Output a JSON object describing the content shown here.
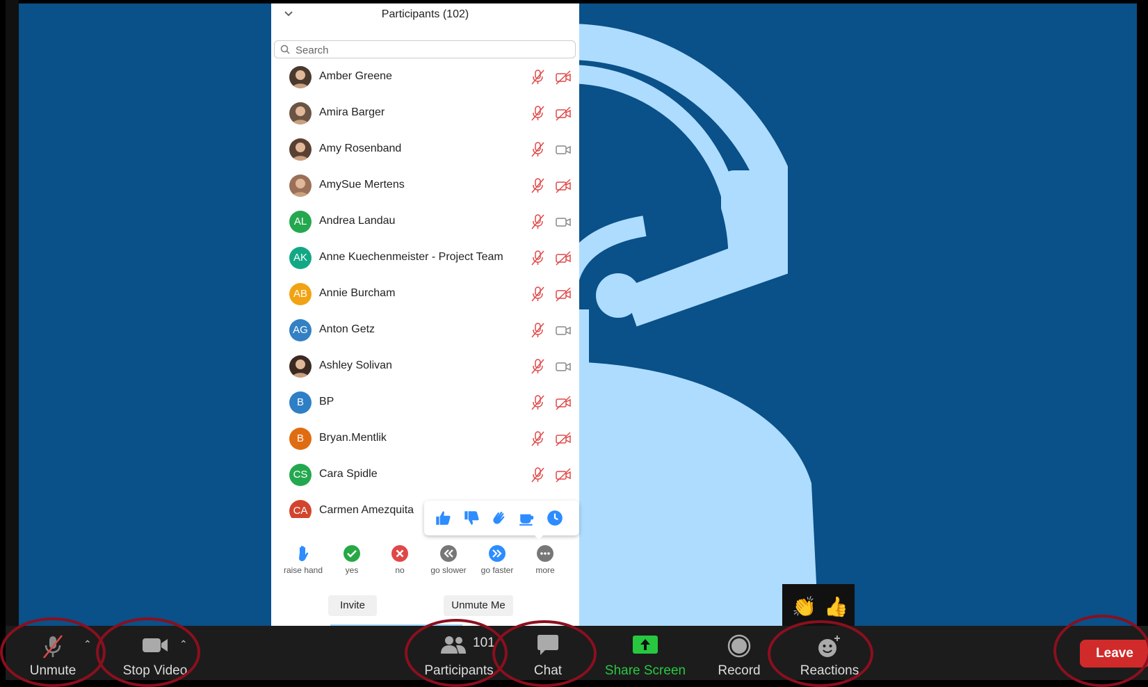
{
  "panel": {
    "title": "Participants (102)",
    "search_placeholder": "Search",
    "participants": [
      {
        "name": "Amber Greene",
        "initials": "",
        "avatar_color": "#4a3a2e",
        "mic": "muted",
        "video": "off"
      },
      {
        "name": "Amira Barger",
        "initials": "",
        "avatar_color": "#6b5443",
        "mic": "muted",
        "video": "off"
      },
      {
        "name": "Amy Rosenband",
        "initials": "",
        "avatar_color": "#5a4033",
        "mic": "muted",
        "video": "on"
      },
      {
        "name": "AmySue Mertens",
        "initials": "",
        "avatar_color": "#9a7058",
        "mic": "muted",
        "video": "off"
      },
      {
        "name": "Andrea Landau",
        "initials": "AL",
        "avatar_color": "#24a84f",
        "mic": "muted",
        "video": "on"
      },
      {
        "name": "Anne Kuechenmeister - Project Team",
        "initials": "AK",
        "avatar_color": "#12a886",
        "mic": "muted",
        "video": "off"
      },
      {
        "name": "Annie Burcham",
        "initials": "AB",
        "avatar_color": "#f2a313",
        "mic": "muted",
        "video": "off"
      },
      {
        "name": "Anton Getz",
        "initials": "AG",
        "avatar_color": "#3380c4",
        "mic": "muted",
        "video": "on"
      },
      {
        "name": "Ashley Solivan",
        "initials": "",
        "avatar_color": "#3b2a22",
        "mic": "muted",
        "video": "on"
      },
      {
        "name": "BP",
        "initials": "B",
        "avatar_color": "#2e7fc5",
        "mic": "muted",
        "video": "off"
      },
      {
        "name": "Bryan.Mentlik",
        "initials": "B",
        "avatar_color": "#e06c12",
        "mic": "muted",
        "video": "off"
      },
      {
        "name": "Cara Spidle",
        "initials": "CS",
        "avatar_color": "#24a84f",
        "mic": "muted",
        "video": "off"
      },
      {
        "name": "Carmen Amezquita",
        "initials": "CA",
        "avatar_color": "#d2452d",
        "mic": "muted",
        "video": "off"
      }
    ],
    "feedback": [
      {
        "label": "raise hand",
        "icon": "raise-hand-icon"
      },
      {
        "label": "yes",
        "icon": "check-circle-icon"
      },
      {
        "label": "no",
        "icon": "x-circle-icon"
      },
      {
        "label": "go slower",
        "icon": "rewind-circle-icon"
      },
      {
        "label": "go faster",
        "icon": "fast-forward-circle-icon"
      },
      {
        "label": "more",
        "icon": "more-dots-icon"
      }
    ],
    "invite_label": "Invite",
    "unmute_me_label": "Unmute Me"
  },
  "toolbar": {
    "unmute_label": "Unmute",
    "stop_video_label": "Stop Video",
    "participants_label": "Participants",
    "participants_count": "101",
    "chat_label": "Chat",
    "share_screen_label": "Share Screen",
    "record_label": "Record",
    "reactions_label": "Reactions",
    "leave_label": "Leave"
  },
  "colors": {
    "stage": "#0a5089",
    "avatar_art": "#aedcff",
    "share_green": "#27c840",
    "leave_red": "#d12a2a",
    "highlight_ring": "#8b0f1e",
    "muted_red": "#e04848",
    "emoji_blue": "#2d8cff"
  }
}
